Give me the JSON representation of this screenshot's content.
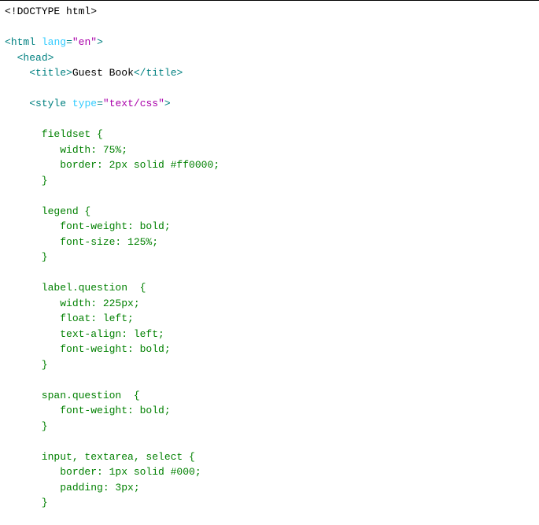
{
  "code": {
    "doctype": "<!DOCTYPE html>",
    "html_open_1": "<",
    "html_open_2": "html",
    "html_open_3": " ",
    "html_open_4": "lang",
    "html_open_5": "=",
    "html_open_6": "\"en\"",
    "html_open_7": ">",
    "head_open": "<head>",
    "title_open_1": "<",
    "title_open_2": "title",
    "title_open_3": ">",
    "title_text": "Guest Book",
    "title_close_1": "</",
    "title_close_2": "title",
    "title_close_3": ">",
    "style_open_1": "<",
    "style_open_2": "style",
    "style_open_3": " ",
    "style_open_4": "type",
    "style_open_5": "=",
    "style_open_6": "\"text/css\"",
    "style_open_7": ">",
    "css_block": "      fieldset {\n         width: 75%;\n         border: 2px solid #ff0000;\n      }\n\n      legend {\n         font-weight: bold;\n         font-size: 125%;\n      }\n\n      label.question  {\n         width: 225px;\n         float: left;\n         text-align: left;\n         font-weight: bold;\n      }\n\n      span.question  {\n         font-weight: bold;\n      }\n\n      input, textarea, select {\n         border: 1px solid #000;\n         padding: 3px;\n      }"
  }
}
